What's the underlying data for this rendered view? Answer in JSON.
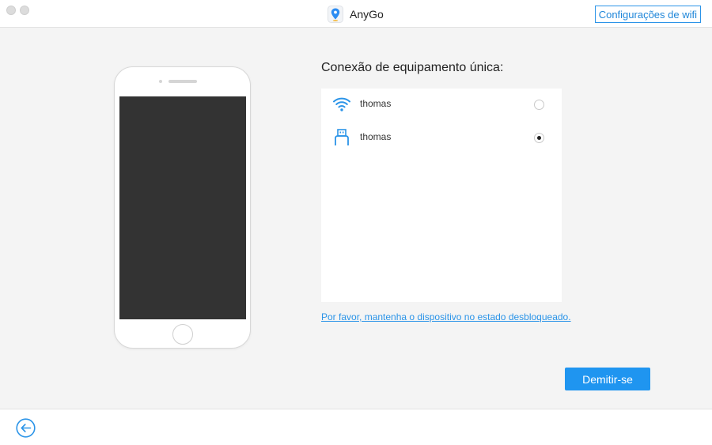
{
  "app": {
    "title": "AnyGo",
    "icon": "location-pin-icon"
  },
  "header": {
    "wifi_settings_label": "Configurações de wifi"
  },
  "colors": {
    "accent": "#1f95f0",
    "link": "#2b94e8",
    "phone_screen": "#333333"
  },
  "main": {
    "heading": "Conexão de equipamento única:",
    "devices": [
      {
        "name": "thomas",
        "icon": "wifi-icon",
        "selected": false
      },
      {
        "name": "thomas",
        "icon": "usb-icon",
        "selected": true
      }
    ],
    "unlock_hint": "Por favor, mantenha o dispositivo no estado desbloqueado.",
    "dismiss_label": "Demitir-se"
  },
  "footer": {
    "back_icon": "arrow-left-circle-icon"
  }
}
